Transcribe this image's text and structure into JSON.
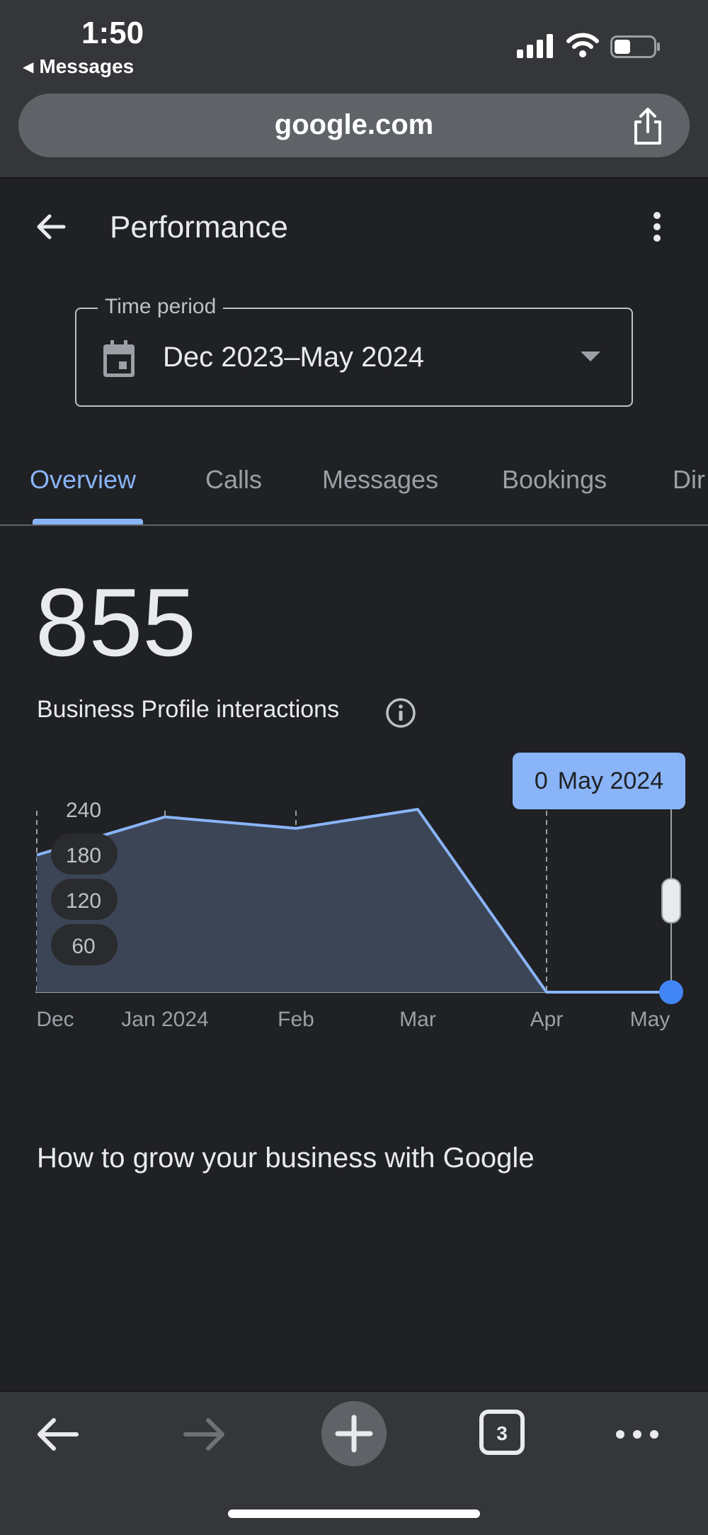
{
  "status_bar": {
    "time": "1:50",
    "back_app": "Messages"
  },
  "browser": {
    "address": "google.com",
    "tabs_count": "3"
  },
  "header": {
    "title": "Performance"
  },
  "time_period": {
    "label": "Time period",
    "value": "Dec 2023–May 2024"
  },
  "tabs": [
    {
      "label": "Overview",
      "active": true
    },
    {
      "label": "Calls",
      "active": false
    },
    {
      "label": "Messages",
      "active": false
    },
    {
      "label": "Bookings",
      "active": false
    },
    {
      "label": "Dir",
      "active": false
    }
  ],
  "metric": {
    "value": "855",
    "label": "Business Profile interactions"
  },
  "tooltip": {
    "value": "0",
    "month": "May 2024"
  },
  "chart_data": {
    "type": "area",
    "x": [
      "Dec",
      "Jan 2024",
      "Feb",
      "Mar",
      "Apr",
      "May"
    ],
    "values": [
      180,
      230,
      215,
      240,
      0,
      0
    ],
    "y_ticks": [
      "240",
      "180",
      "120",
      "60"
    ],
    "ylim": [
      0,
      240
    ],
    "grid": "vertical dashed",
    "colors": {
      "line": "#8ab4f8",
      "fill": "#3b4556",
      "selected_point": "#4285f4"
    },
    "selected_index": 5
  },
  "section": {
    "heading": "How to grow your business with Google"
  },
  "icons": {
    "back": "arrow-left-icon",
    "more": "more-vertical-icon",
    "calendar": "calendar-icon",
    "dropdown": "caret-down-icon",
    "info": "info-icon",
    "share": "share-icon"
  }
}
